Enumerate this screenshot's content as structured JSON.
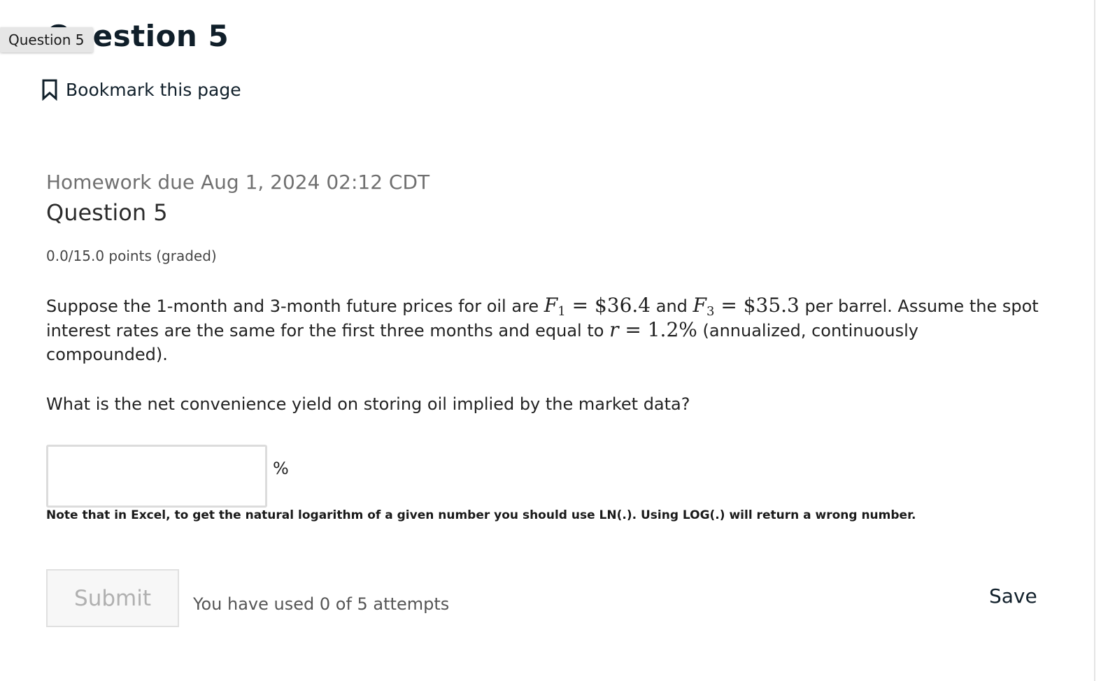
{
  "page": {
    "heading": "Question 5",
    "tooltip": "Question 5"
  },
  "bookmark": {
    "label": "Bookmark this page",
    "icon": "bookmark-icon"
  },
  "problem": {
    "due": "Homework due Aug 1, 2024 02:12 CDT",
    "title": "Question 5",
    "points": "0.0/15.0 points (graded)",
    "prompt": {
      "t1": "Suppose the 1-month and 3-month future prices for oil are ",
      "f1_var": "F",
      "f1_sub": "1",
      "f1_eq": " = ",
      "f1_val": "$36.4",
      "t2": " and ",
      "f3_var": "F",
      "f3_sub": "3",
      "f3_eq": " = ",
      "f3_val": "$35.3",
      "t3": " per barrel. Assume the spot interest rates are the same for the first three months and equal to ",
      "r_var": "r",
      "r_eq": " = ",
      "r_val": "1.2%",
      "t4": " (annualized, continuously compounded)."
    },
    "question": "What is the net convenience yield on storing oil implied by the market data?",
    "answer": {
      "value": "",
      "placeholder": "",
      "unit": "%"
    },
    "note": "Note that in Excel, to get the natural logarithm of a given number you should use LN(.). Using LOG(.) will return a wrong number."
  },
  "actions": {
    "submit_label": "Submit",
    "attempts_text": "You have used 0 of 5 attempts",
    "save_label": "Save"
  }
}
